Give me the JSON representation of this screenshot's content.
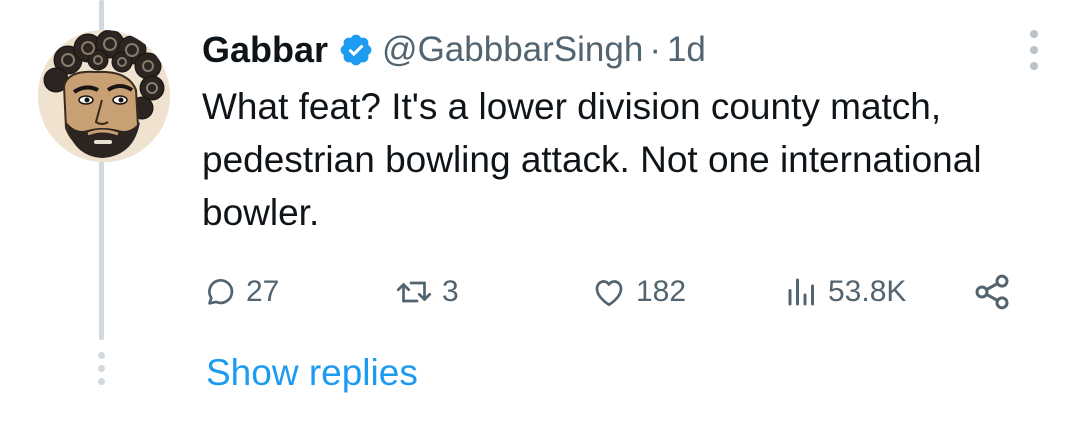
{
  "tweet": {
    "author_name": "Gabbar",
    "handle": "@GabbbarSingh",
    "separator": "·",
    "time": "1d",
    "text": "What feat? It's a lower division county match, pedestrian bowling attack. Not one international bowler.",
    "verified_icon": "verified-badge-icon",
    "avatar": "cartoon-face-avatar"
  },
  "actions": {
    "reply": {
      "icon": "reply-icon",
      "count": "27"
    },
    "retweet": {
      "icon": "retweet-icon",
      "count": "3"
    },
    "like": {
      "icon": "heart-icon",
      "count": "182"
    },
    "views": {
      "icon": "views-bar-chart-icon",
      "count": "53.8K"
    },
    "share": {
      "icon": "share-icon"
    }
  },
  "show_replies_label": "Show replies",
  "colors": {
    "text": "#0f1419",
    "muted": "#536471",
    "accent": "#1d9bf0",
    "thread_line": "#cfd9de"
  }
}
